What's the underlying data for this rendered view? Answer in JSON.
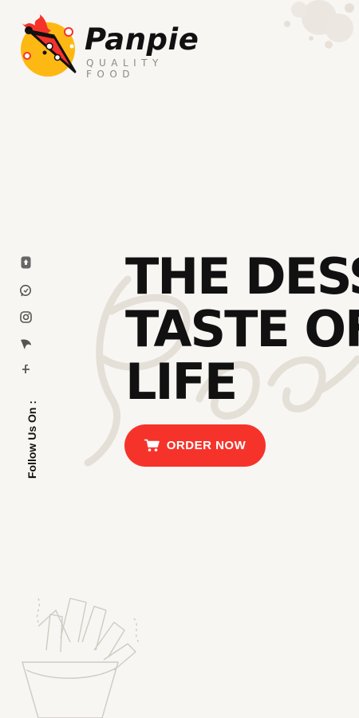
{
  "header": {
    "brand_name": "Panpie",
    "tagline": "QUALITY FOOD"
  },
  "social": {
    "label": "Follow Us On :",
    "icons": [
      "home-icon",
      "chat-icon",
      "instagram-icon",
      "behance-icon",
      "facebook-icon"
    ]
  },
  "hero": {
    "title_lines": [
      "THE DESS",
      "TASTE OF",
      "LIFE"
    ],
    "button_label": "ORDER NOW",
    "button_icon": "cart-icon"
  },
  "colors": {
    "accent": "#f6332b",
    "background": "#f8f6f2",
    "text": "#111111",
    "logo_yellow": "#fdb813"
  }
}
